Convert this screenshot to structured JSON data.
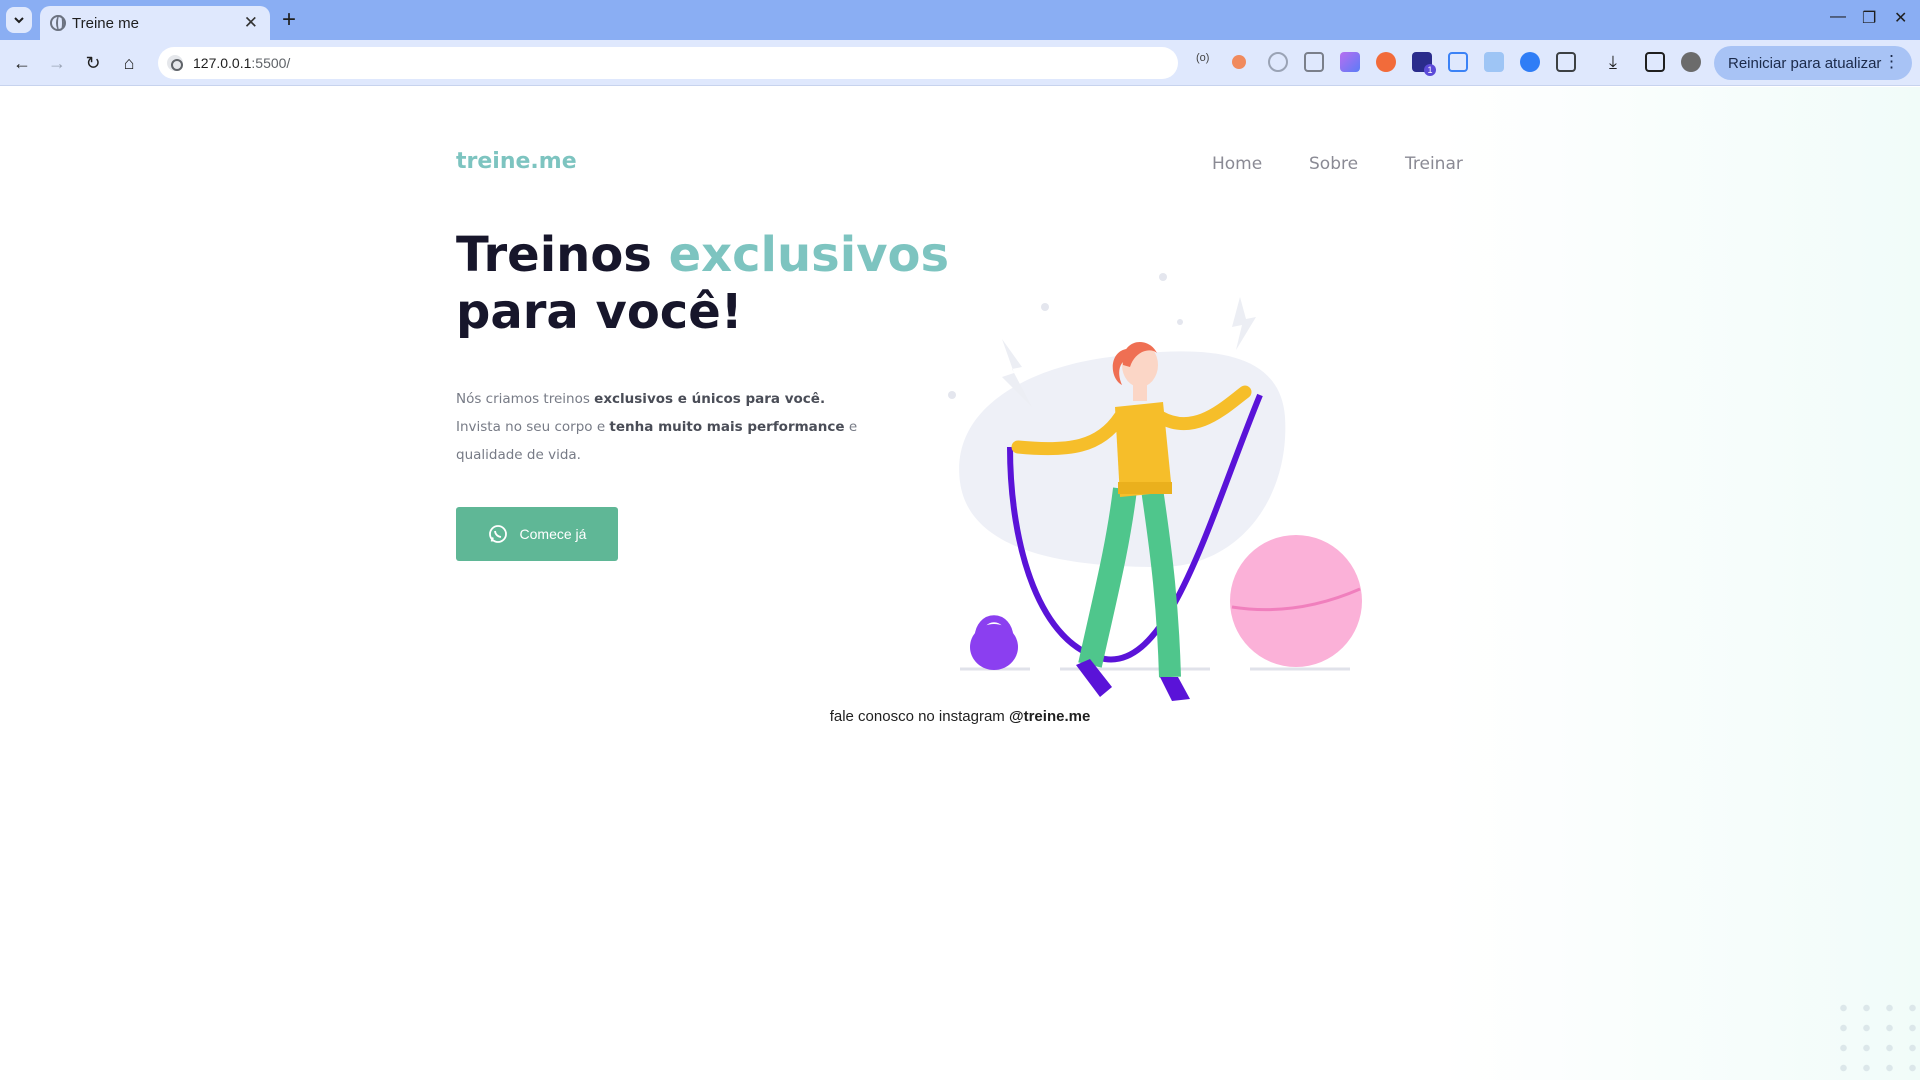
{
  "browser": {
    "tab_title": "Treine me",
    "url_host": "127.0.0.1",
    "url_path": ":5500/",
    "restart_label": "Reiniciar para atualizar",
    "extension_badge": "1"
  },
  "site": {
    "logo": "treine.me",
    "nav": [
      "Home",
      "Sobre",
      "Treinar"
    ],
    "title_line1": "Treinos ",
    "title_accent": "exclusivos",
    "title_line2": "para você!",
    "text_1": "Nós criamos treinos ",
    "text_1_bold": "exclusivos e únicos para você.",
    "text_2": "Invista no seu corpo e ",
    "text_2_bold": "tenha muito mais performance",
    "text_2_end": " e",
    "text_3": "qualidade de vida.",
    "cta_label": "Comece já",
    "footer_text": "fale conosco no instagram ",
    "footer_handle": "@treine.me"
  },
  "colors": {
    "browser_frame": "#8aaef3",
    "accent_teal": "#7dc4c0",
    "cta_green": "#5fb796",
    "title_dark": "#17162b"
  }
}
